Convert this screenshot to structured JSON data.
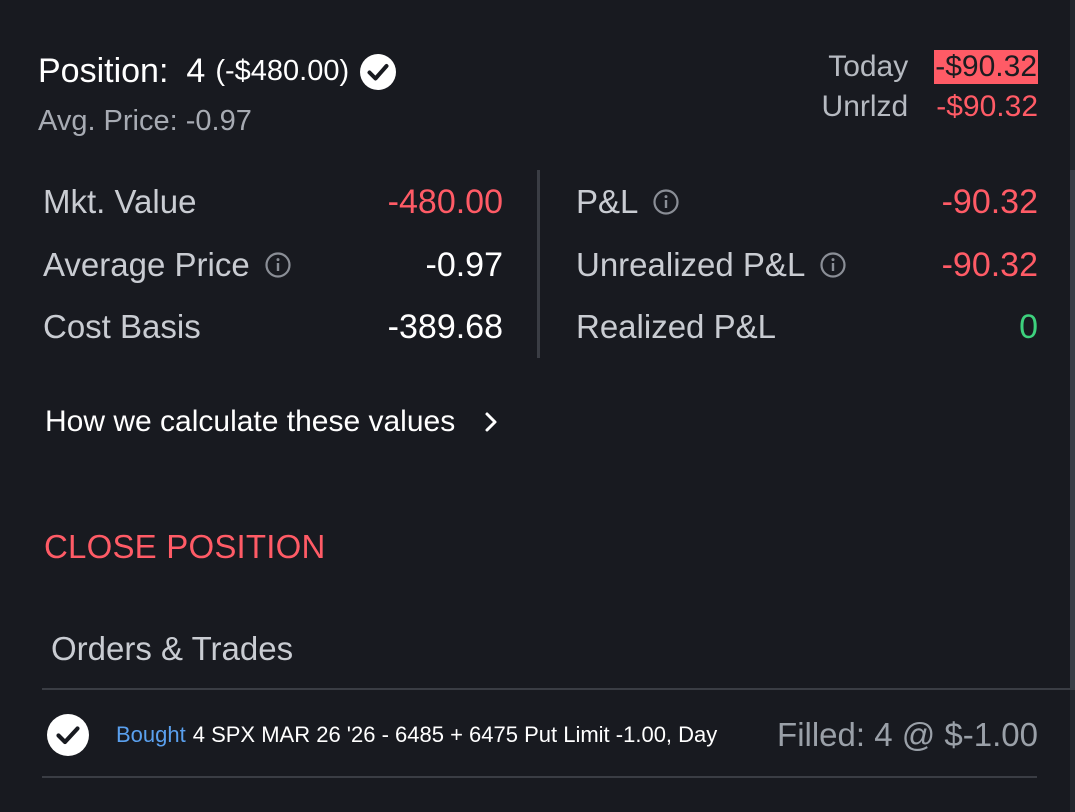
{
  "position": {
    "label": "Position:",
    "quantity": "4",
    "value": "(-$480.00)",
    "avg_price_label": "Avg. Price:",
    "avg_price_value": "-0.97",
    "status_icon": "check-circle-icon"
  },
  "summary": {
    "today_label": "Today",
    "today_value": "-$90.32",
    "unrlzd_label": "Unrlzd",
    "unrlzd_value": "-$90.32"
  },
  "metrics": {
    "left": [
      {
        "label": "Mkt. Value",
        "value": "-480.00",
        "info": false
      },
      {
        "label": "Average Price",
        "value": "-0.97",
        "info": true
      },
      {
        "label": "Cost Basis",
        "value": "-389.68",
        "info": false
      }
    ],
    "right": [
      {
        "label": "P&L",
        "value": "-90.32",
        "info": true
      },
      {
        "label": "Unrealized P&L",
        "value": "-90.32",
        "info": true
      },
      {
        "label": "Realized P&L",
        "value": "0",
        "info": false
      }
    ]
  },
  "calc_link": {
    "label": "How we calculate these values",
    "icon": "chevron-right-icon"
  },
  "close_position": {
    "label": "CLOSE POSITION"
  },
  "orders": {
    "title": "Orders & Trades",
    "items": [
      {
        "side": "Bought",
        "description": "4 SPX MAR 26 '26 - 6485 + 6475 Put Limit -1.00, Day",
        "status": "Filled: 4 @ $-1.00",
        "icon": "check-circle-icon"
      }
    ]
  },
  "colors": {
    "background": "#181a20",
    "negative": "#ff5b66",
    "positive": "#3dd17d",
    "link_blue": "#5aa0ee",
    "muted_text": "#a7abb3",
    "divider": "#3a3d44"
  }
}
